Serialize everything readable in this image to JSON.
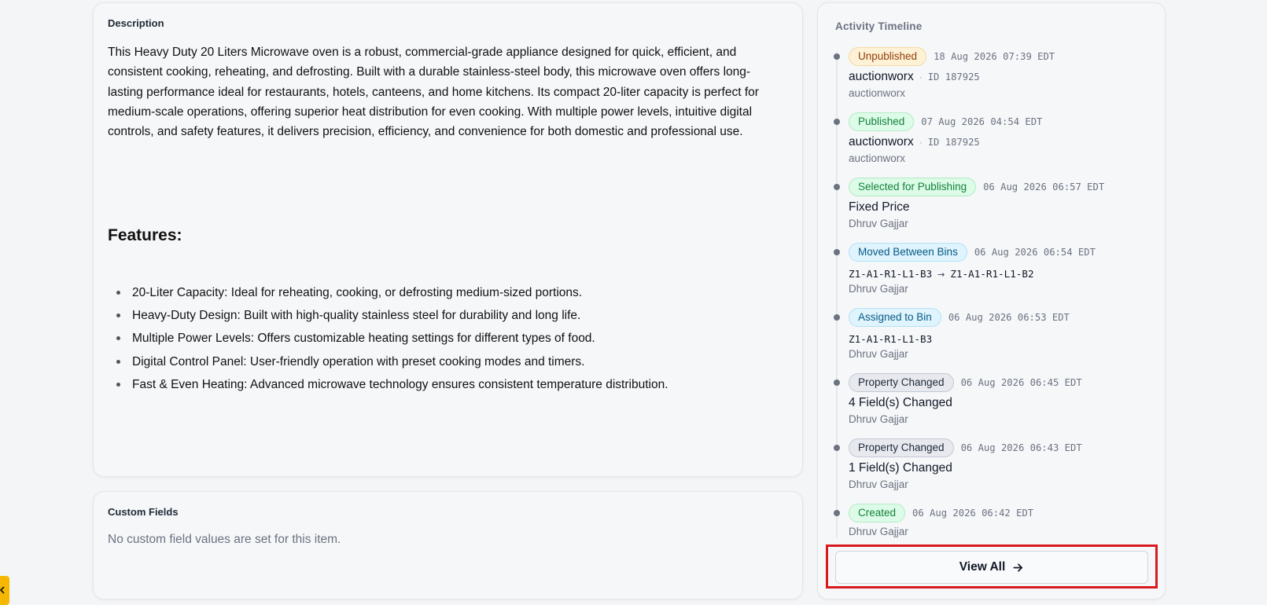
{
  "description": {
    "heading": "Description",
    "body": "This Heavy Duty 20 Liters Microwave oven is a robust, commercial-grade appliance designed for quick, efficient, and consistent cooking, reheating, and defrosting. Built with a durable stainless-steel body, this microwave oven offers long-lasting performance ideal for restaurants, hotels, canteens, and home kitchens. Its compact 20-liter capacity is perfect for medium-scale operations, offering superior heat distribution for even cooking. With multiple power levels, intuitive digital controls, and safety features, it delivers precision, efficiency, and convenience for both domestic and professional use.",
    "features_title": "Features:",
    "features": [
      "20-Liter Capacity: Ideal for reheating, cooking, or defrosting medium-sized portions.",
      "Heavy-Duty Design: Built with high-quality stainless steel for durability and long life.",
      "Multiple Power Levels: Offers customizable heating settings for different types of food.",
      "Digital Control Panel: User-friendly operation with preset cooking modes and timers.",
      "Fast & Even Heating: Advanced microwave technology ensures consistent temperature distribution."
    ]
  },
  "custom_fields": {
    "heading": "Custom Fields",
    "empty_message": "No custom field values are set for this item."
  },
  "timeline": {
    "heading": "Activity Timeline",
    "events": [
      {
        "badge": "Unpublished",
        "badge_color": "#fdf1d6",
        "timestamp": "18 Aug 2026 07:39 EDT",
        "title": "auctionworx",
        "separator": "·",
        "id_text": "ID 187925",
        "user": "auctionworx"
      },
      {
        "badge": "Published",
        "badge_color": "#dcfce7",
        "timestamp": "07 Aug 2026 04:54 EDT",
        "title": "auctionworx",
        "separator": "·",
        "id_text": "ID 187925",
        "user": "auctionworx"
      },
      {
        "badge": "Selected for Publishing",
        "badge_color": "#dcfce7",
        "timestamp": "06 Aug 2026 06:57 EDT",
        "title": "Fixed Price",
        "user": "Dhruv Gajjar"
      },
      {
        "badge": "Moved Between Bins",
        "badge_color": "#dff4fd",
        "timestamp": "06 Aug 2026 06:54 EDT",
        "from_bin": "Z1-A1-R1-L1-B3",
        "arrow": "→",
        "to_bin": "Z1-A1-R1-L1-B2",
        "user": "Dhruv Gajjar"
      },
      {
        "badge": "Assigned to Bin",
        "badge_color": "#dff4fd",
        "timestamp": "06 Aug 2026 06:53 EDT",
        "bin": "Z1-A1-R1-L1-B3",
        "user": "Dhruv Gajjar"
      },
      {
        "badge": "Property Changed",
        "badge_color": "#e7e9ef",
        "timestamp": "06 Aug 2026 06:45 EDT",
        "title": "4 Field(s) Changed",
        "user": "Dhruv Gajjar"
      },
      {
        "badge": "Property Changed",
        "badge_color": "#e7e9ef",
        "timestamp": "06 Aug 2026 06:43 EDT",
        "title": "1 Field(s) Changed",
        "user": "Dhruv Gajjar"
      },
      {
        "badge": "Created",
        "badge_color": "#dcfce7",
        "timestamp": "06 Aug 2026 06:42 EDT",
        "user": "Dhruv Gajjar"
      }
    ],
    "view_all_label": "View All",
    "highlight_color": "#d71920"
  },
  "side_tab": {
    "icon": "chevron-left-icon",
    "color": "#f5b700"
  }
}
